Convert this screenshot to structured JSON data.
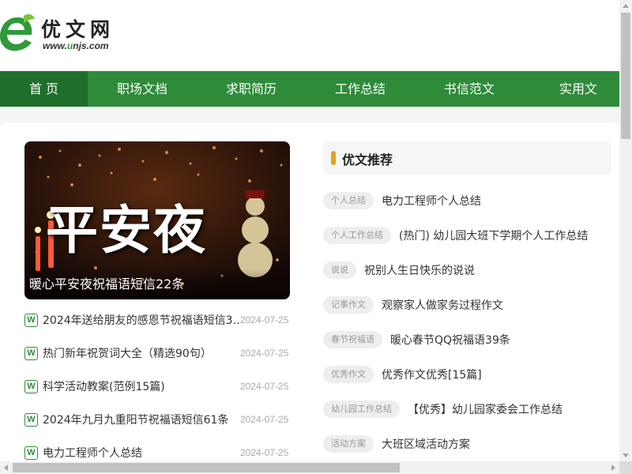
{
  "logo": {
    "title": "优文网",
    "url_prefix": "www.",
    "url_highlight": "u",
    "url_suffix": "njs.com",
    "icon": "leaf-e-logo-icon"
  },
  "nav": {
    "items": [
      {
        "label": "首 页",
        "active": true
      },
      {
        "label": "职场文档",
        "active": false
      },
      {
        "label": "求职简历",
        "active": false
      },
      {
        "label": "工作总结",
        "active": false
      },
      {
        "label": "书信范文",
        "active": false
      },
      {
        "label": "实用文",
        "active": false
      }
    ]
  },
  "banner": {
    "image_text": "平安夜",
    "caption": "暖心平安夜祝福语短信22条"
  },
  "left_list": {
    "icon_letter": "W",
    "items": [
      {
        "title": "2024年送给朋友的感恩节祝福语短信3…",
        "date": "2024-07-25"
      },
      {
        "title": "热门新年祝贺词大全（精选90句）",
        "date": "2024-07-25"
      },
      {
        "title": "科学活动教案(范例15篇)",
        "date": "2024-07-25"
      },
      {
        "title": "2024年九月九重阳节祝福语短信61条",
        "date": "2024-07-25"
      },
      {
        "title": "电力工程师个人总结",
        "date": "2024-07-25"
      }
    ]
  },
  "recommend": {
    "heading": "优文推荐",
    "items": [
      {
        "tag": "个人总结",
        "title": "电力工程师个人总结"
      },
      {
        "tag": "个人工作总结",
        "title": "(热门) 幼儿园大班下学期个人工作总结"
      },
      {
        "tag": "说说",
        "title": "祝别人生日快乐的说说"
      },
      {
        "tag": "记事作文",
        "title": "观察家人做家务过程作文"
      },
      {
        "tag": "春节祝福语",
        "title": "暖心春节QQ祝福语39条"
      },
      {
        "tag": "优秀作文",
        "title": "优秀作文优秀[15篇]"
      },
      {
        "tag": "幼儿园工作总结",
        "title": "【优秀】幼儿园家委会工作总结"
      },
      {
        "tag": "活动方案",
        "title": "大班区域活动方案"
      }
    ]
  },
  "colors": {
    "brand_green": "#2e8b3a",
    "nav_active": "#1f6e2a",
    "accent_bar": "#e4a11b"
  }
}
